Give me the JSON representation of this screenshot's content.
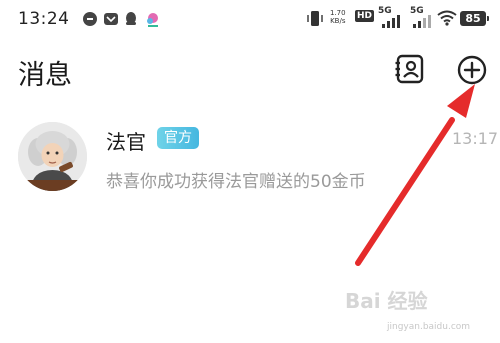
{
  "status_bar": {
    "time": "13:24",
    "network_speed_value": "1.70",
    "network_speed_unit": "KB/s",
    "hd_label": "HD",
    "signal_1": "5G",
    "signal_2": "5G",
    "battery": "85"
  },
  "header": {
    "title": "消息"
  },
  "messages": [
    {
      "sender": "法官",
      "badge": "官方",
      "time": "13:17",
      "preview": "恭喜你成功获得法官赠送的50金币"
    }
  ],
  "watermark": {
    "text": "Bai 经验",
    "sub": "jingyan.baidu.com"
  },
  "colors": {
    "badge_start": "#6fd3e8",
    "badge_end": "#45b7e0",
    "arrow": "#e52b2b"
  }
}
